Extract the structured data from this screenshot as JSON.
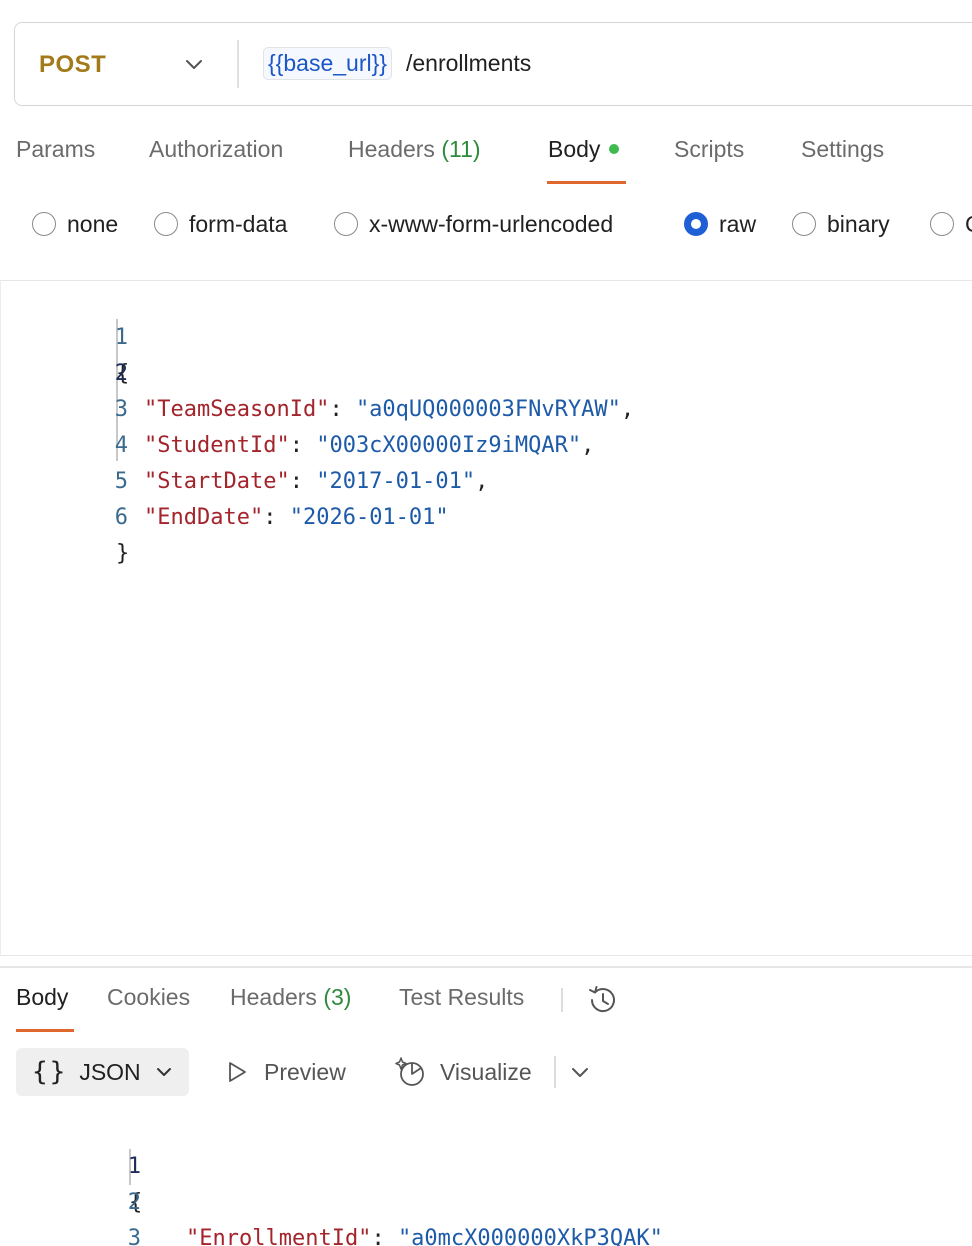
{
  "request": {
    "method": "POST",
    "url_variable": "{{base_url}}",
    "url_path": "/enrollments"
  },
  "request_tabs": {
    "params": "Params",
    "authorization": "Authorization",
    "headers": "Headers",
    "headers_count": "(11)",
    "body": "Body",
    "scripts": "Scripts",
    "settings": "Settings",
    "active": "Body"
  },
  "body_types": {
    "none": "none",
    "form_data": "form-data",
    "urlencoded": "x-www-form-urlencoded",
    "raw": "raw",
    "binary": "binary",
    "graphql_partial": "G",
    "selected": "raw"
  },
  "request_body": {
    "lines": [
      {
        "n": "1",
        "text": "{"
      },
      {
        "n": "2",
        "key": "\"TeamSeasonId\"",
        "value": "\"a0qUQ000003FNvRYAW\"",
        "trail": ","
      },
      {
        "n": "3",
        "key": "\"StudentId\"",
        "value": "\"003cX00000Iz9iMQAR\"",
        "trail": ","
      },
      {
        "n": "4",
        "key": "\"StartDate\"",
        "value": "\"2017-01-01\"",
        "trail": ","
      },
      {
        "n": "5",
        "key": "\"EndDate\"",
        "value": "\"2026-01-01\"",
        "trail": ""
      },
      {
        "n": "6",
        "text": "}"
      }
    ]
  },
  "response_tabs": {
    "body": "Body",
    "cookies": "Cookies",
    "headers": "Headers",
    "headers_count": "(3)",
    "test_results": "Test Results",
    "active": "Body"
  },
  "response_toolbar": {
    "format_icon": "{}",
    "format": "JSON",
    "preview": "Preview",
    "visualize": "Visualize"
  },
  "response_body": {
    "lines": [
      {
        "n": "1",
        "text": "{"
      },
      {
        "n": "2",
        "key": "\"EnrollmentId\"",
        "value": "\"a0mcX000000XkP3QAK\""
      },
      {
        "n": "3",
        "text": "}"
      }
    ]
  },
  "colors": {
    "method": "#a37a1a",
    "accent": "#e0682f",
    "count": "#2f8a3d",
    "json_key": "#a3242b",
    "json_string": "#1d5aa8",
    "radio_selected": "#1f5fd6"
  },
  "icons": [
    "chevron-down-icon",
    "status-dot-icon",
    "history-icon",
    "play-triangle-icon",
    "visualize-sparkle-icon"
  ]
}
